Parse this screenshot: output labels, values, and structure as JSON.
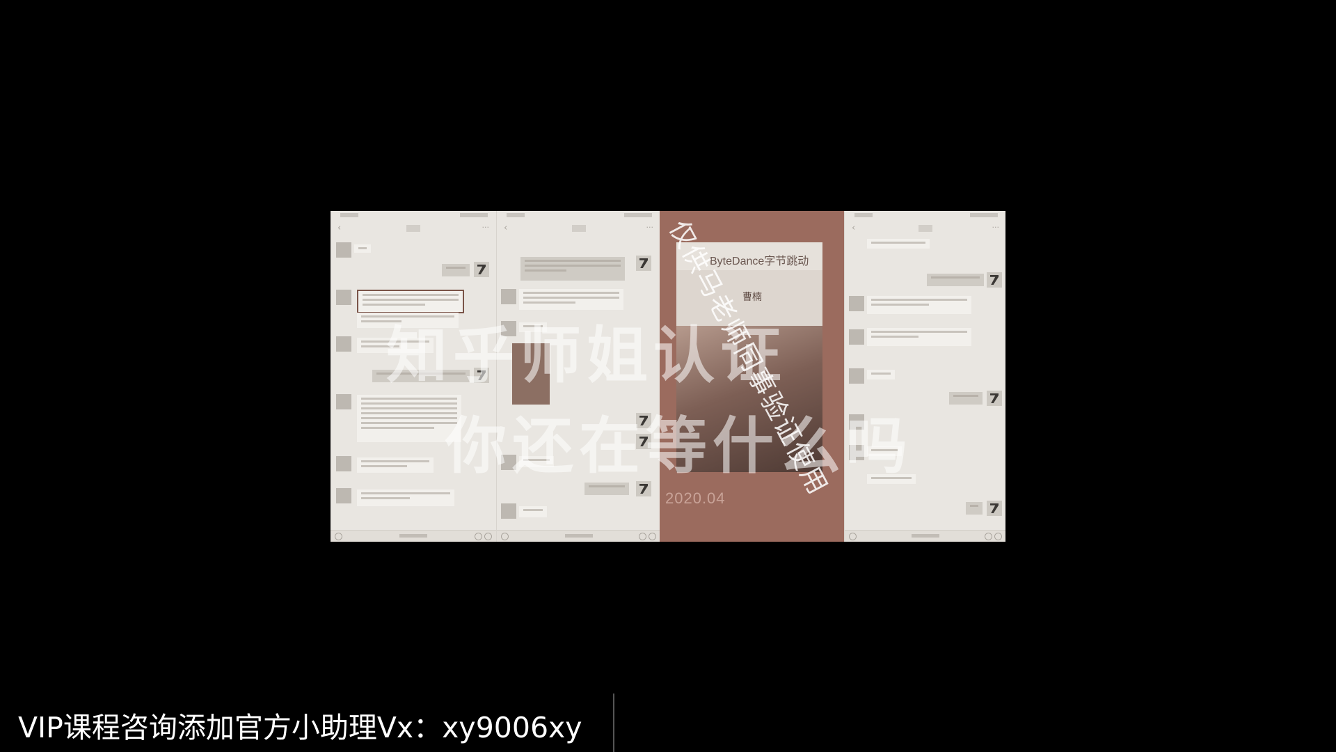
{
  "overlay": {
    "line_1": "知乎师姐认证",
    "line_2": "你还在等什么吗",
    "diagonal_watermark": "仅供马老师同事验证使用"
  },
  "card": {
    "brand": "ByteDance字节跳动",
    "name": "曹楠",
    "date": "2020.04"
  },
  "caption": {
    "text": "VIP课程咨询添加官方小助理Vx：xy9006xy"
  },
  "icons": [
    "back-arrow-icon",
    "more-icon",
    "emoji-icon",
    "plus-icon",
    "voice-icon"
  ],
  "colors": {
    "background": "#000000",
    "chat_panel": "#e9e6e1",
    "card_panel": "#9b6b5e",
    "highlight_box": "#7a5448"
  }
}
